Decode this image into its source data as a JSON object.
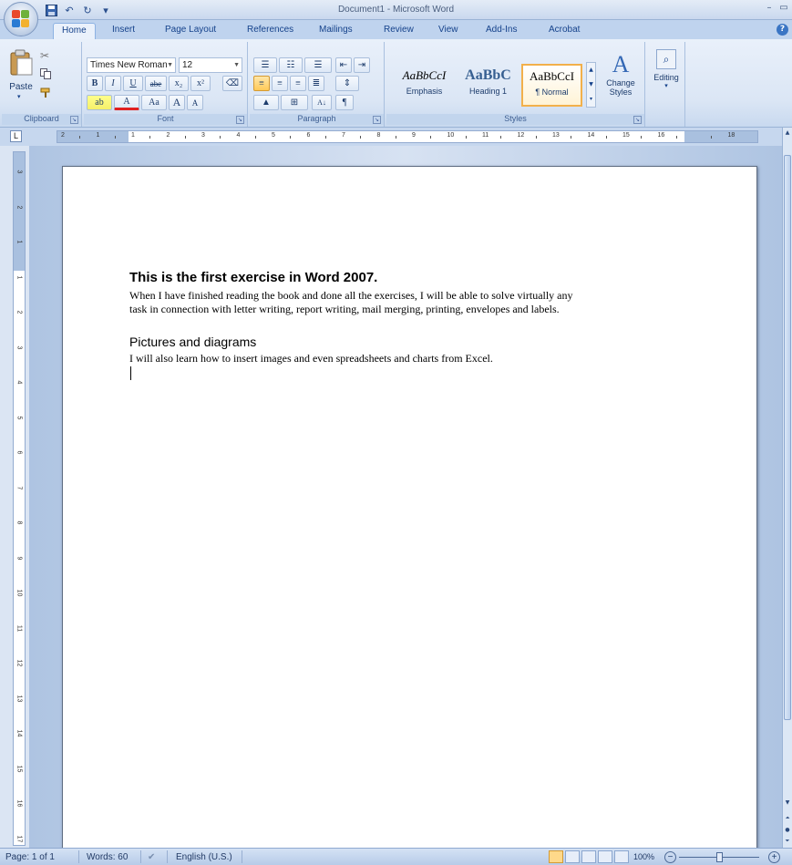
{
  "window": {
    "title": "Document1 - Microsoft Word"
  },
  "quick_access": {
    "save_icon": "save-icon",
    "undo_glyph": "↶",
    "redo_glyph": "↻",
    "more_glyph": "▾"
  },
  "tabs": [
    {
      "label": "Home",
      "active": true
    },
    {
      "label": "Insert"
    },
    {
      "label": "Page Layout"
    },
    {
      "label": "References"
    },
    {
      "label": "Mailings"
    },
    {
      "label": "Review"
    },
    {
      "label": "View"
    },
    {
      "label": "Add-Ins"
    },
    {
      "label": "Acrobat"
    }
  ],
  "ribbon": {
    "clipboard": {
      "label": "Clipboard",
      "paste_label": "Paste"
    },
    "font": {
      "label": "Font",
      "family": "Times New Roman",
      "size": "12",
      "bold": "B",
      "italic": "I",
      "underline": "U",
      "strike": "abe",
      "subscript": "x₂",
      "superscript": "x²",
      "highlight": "ab",
      "font_color": "A",
      "change_case": "Aa",
      "grow": "A",
      "shrink": "A"
    },
    "paragraph": {
      "label": "Paragraph",
      "sort": "A↓",
      "pilcrow": "¶"
    },
    "styles": {
      "label": "Styles",
      "items": [
        {
          "sample": "AaBbCcI",
          "name": "Emphasis"
        },
        {
          "sample": "AaBbC",
          "name": "Heading 1"
        },
        {
          "sample": "AaBbCcI",
          "name": "¶ Normal",
          "selected": true
        }
      ],
      "change_styles": "Change Styles"
    },
    "editing": {
      "label": "Editing"
    }
  },
  "ruler": {
    "tab_selector": "L",
    "h_numbers": [
      "2",
      "1",
      "1",
      "2",
      "3",
      "4",
      "5",
      "6",
      "7",
      "8",
      "9",
      "10",
      "11",
      "12",
      "13",
      "14",
      "15",
      "16",
      "18"
    ],
    "v_numbers": [
      "3",
      "2",
      "1",
      "1",
      "2",
      "3",
      "4",
      "5",
      "6",
      "7",
      "8",
      "9",
      "10",
      "11",
      "12",
      "13",
      "14",
      "15",
      "16",
      "17"
    ]
  },
  "document": {
    "heading": "This is the first exercise in Word 2007.",
    "para1_line1": "When I have finished reading the book and done all the exercises, I will be able to solve virtually any",
    "para1_line2": "task in connection with letter writing, report writing, mail merging, printing, envelopes and labels.",
    "subheading": "Pictures and diagrams",
    "para2": "I will also learn how to insert images and even spreadsheets and charts from Excel."
  },
  "status": {
    "page": "Page: 1 of 1",
    "words": "Words: 60",
    "language": "English (U.S.)",
    "zoom": "100%",
    "zoom_out": "−",
    "zoom_in": "+"
  },
  "colors": {
    "accent": "#15428b",
    "ribbon_bg": "#dbe6f5",
    "selected_style": "#f2b04b"
  }
}
